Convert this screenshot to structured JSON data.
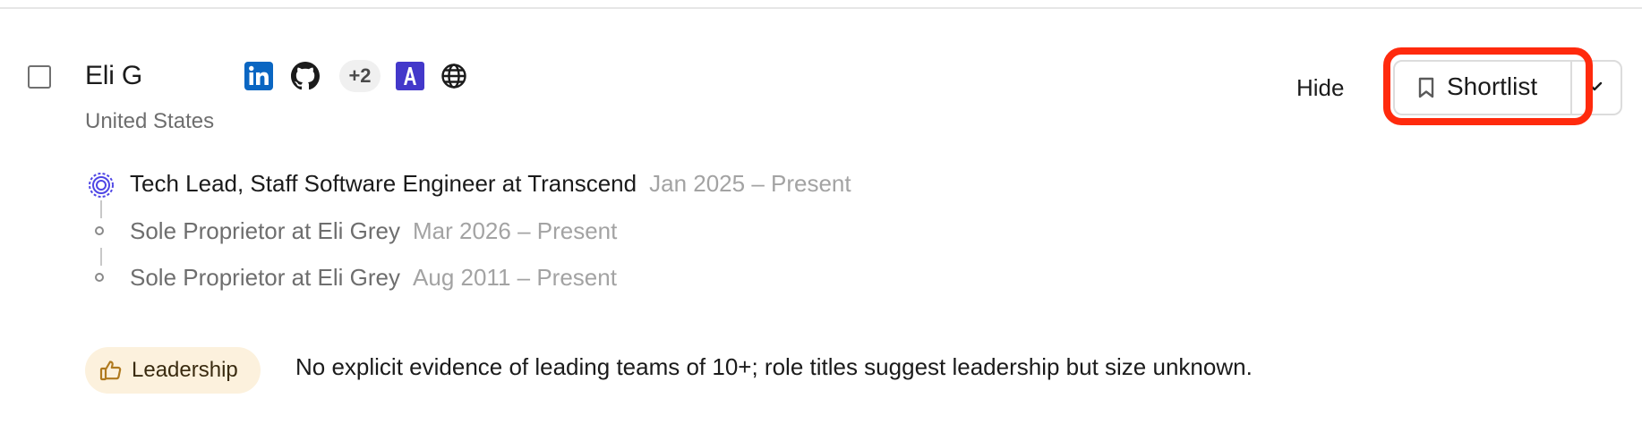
{
  "candidate": {
    "name": "Eli G",
    "location": "United States",
    "more_links_label": "+2"
  },
  "actions": {
    "hide_label": "Hide",
    "shortlist_label": "Shortlist"
  },
  "experience": [
    {
      "title": "Tech Lead, Staff Software Engineer at Transcend",
      "dates": "Jan 2025 – Present"
    },
    {
      "title": "Sole Proprietor at Eli Grey",
      "dates": "Mar 2026 – Present"
    },
    {
      "title": "Sole Proprietor at Eli Grey",
      "dates": "Aug 2011 – Present"
    }
  ],
  "criteria": {
    "badge_label": "Leadership",
    "evidence_text": "No explicit evidence of leading teams of 10+; role titles suggest leadership but size unknown."
  },
  "icons": {
    "linkedin": "linkedin-icon",
    "github": "github-icon",
    "a_brand": "angellist-a-icon",
    "website": "globe-icon",
    "bookmark": "bookmark-icon",
    "chevron": "chevron-down-icon",
    "thumb": "thumbs-up-icon",
    "company_logo": "transcend-logo-icon"
  },
  "colors": {
    "linkedin_blue": "#0a66c2",
    "a_brand_purple": "#4338ca",
    "highlight_red": "#ff2a0d",
    "badge_bg": "#fcf1dd",
    "badge_icon": "#b07a1f",
    "company_logo_blue": "#4f46e5"
  }
}
